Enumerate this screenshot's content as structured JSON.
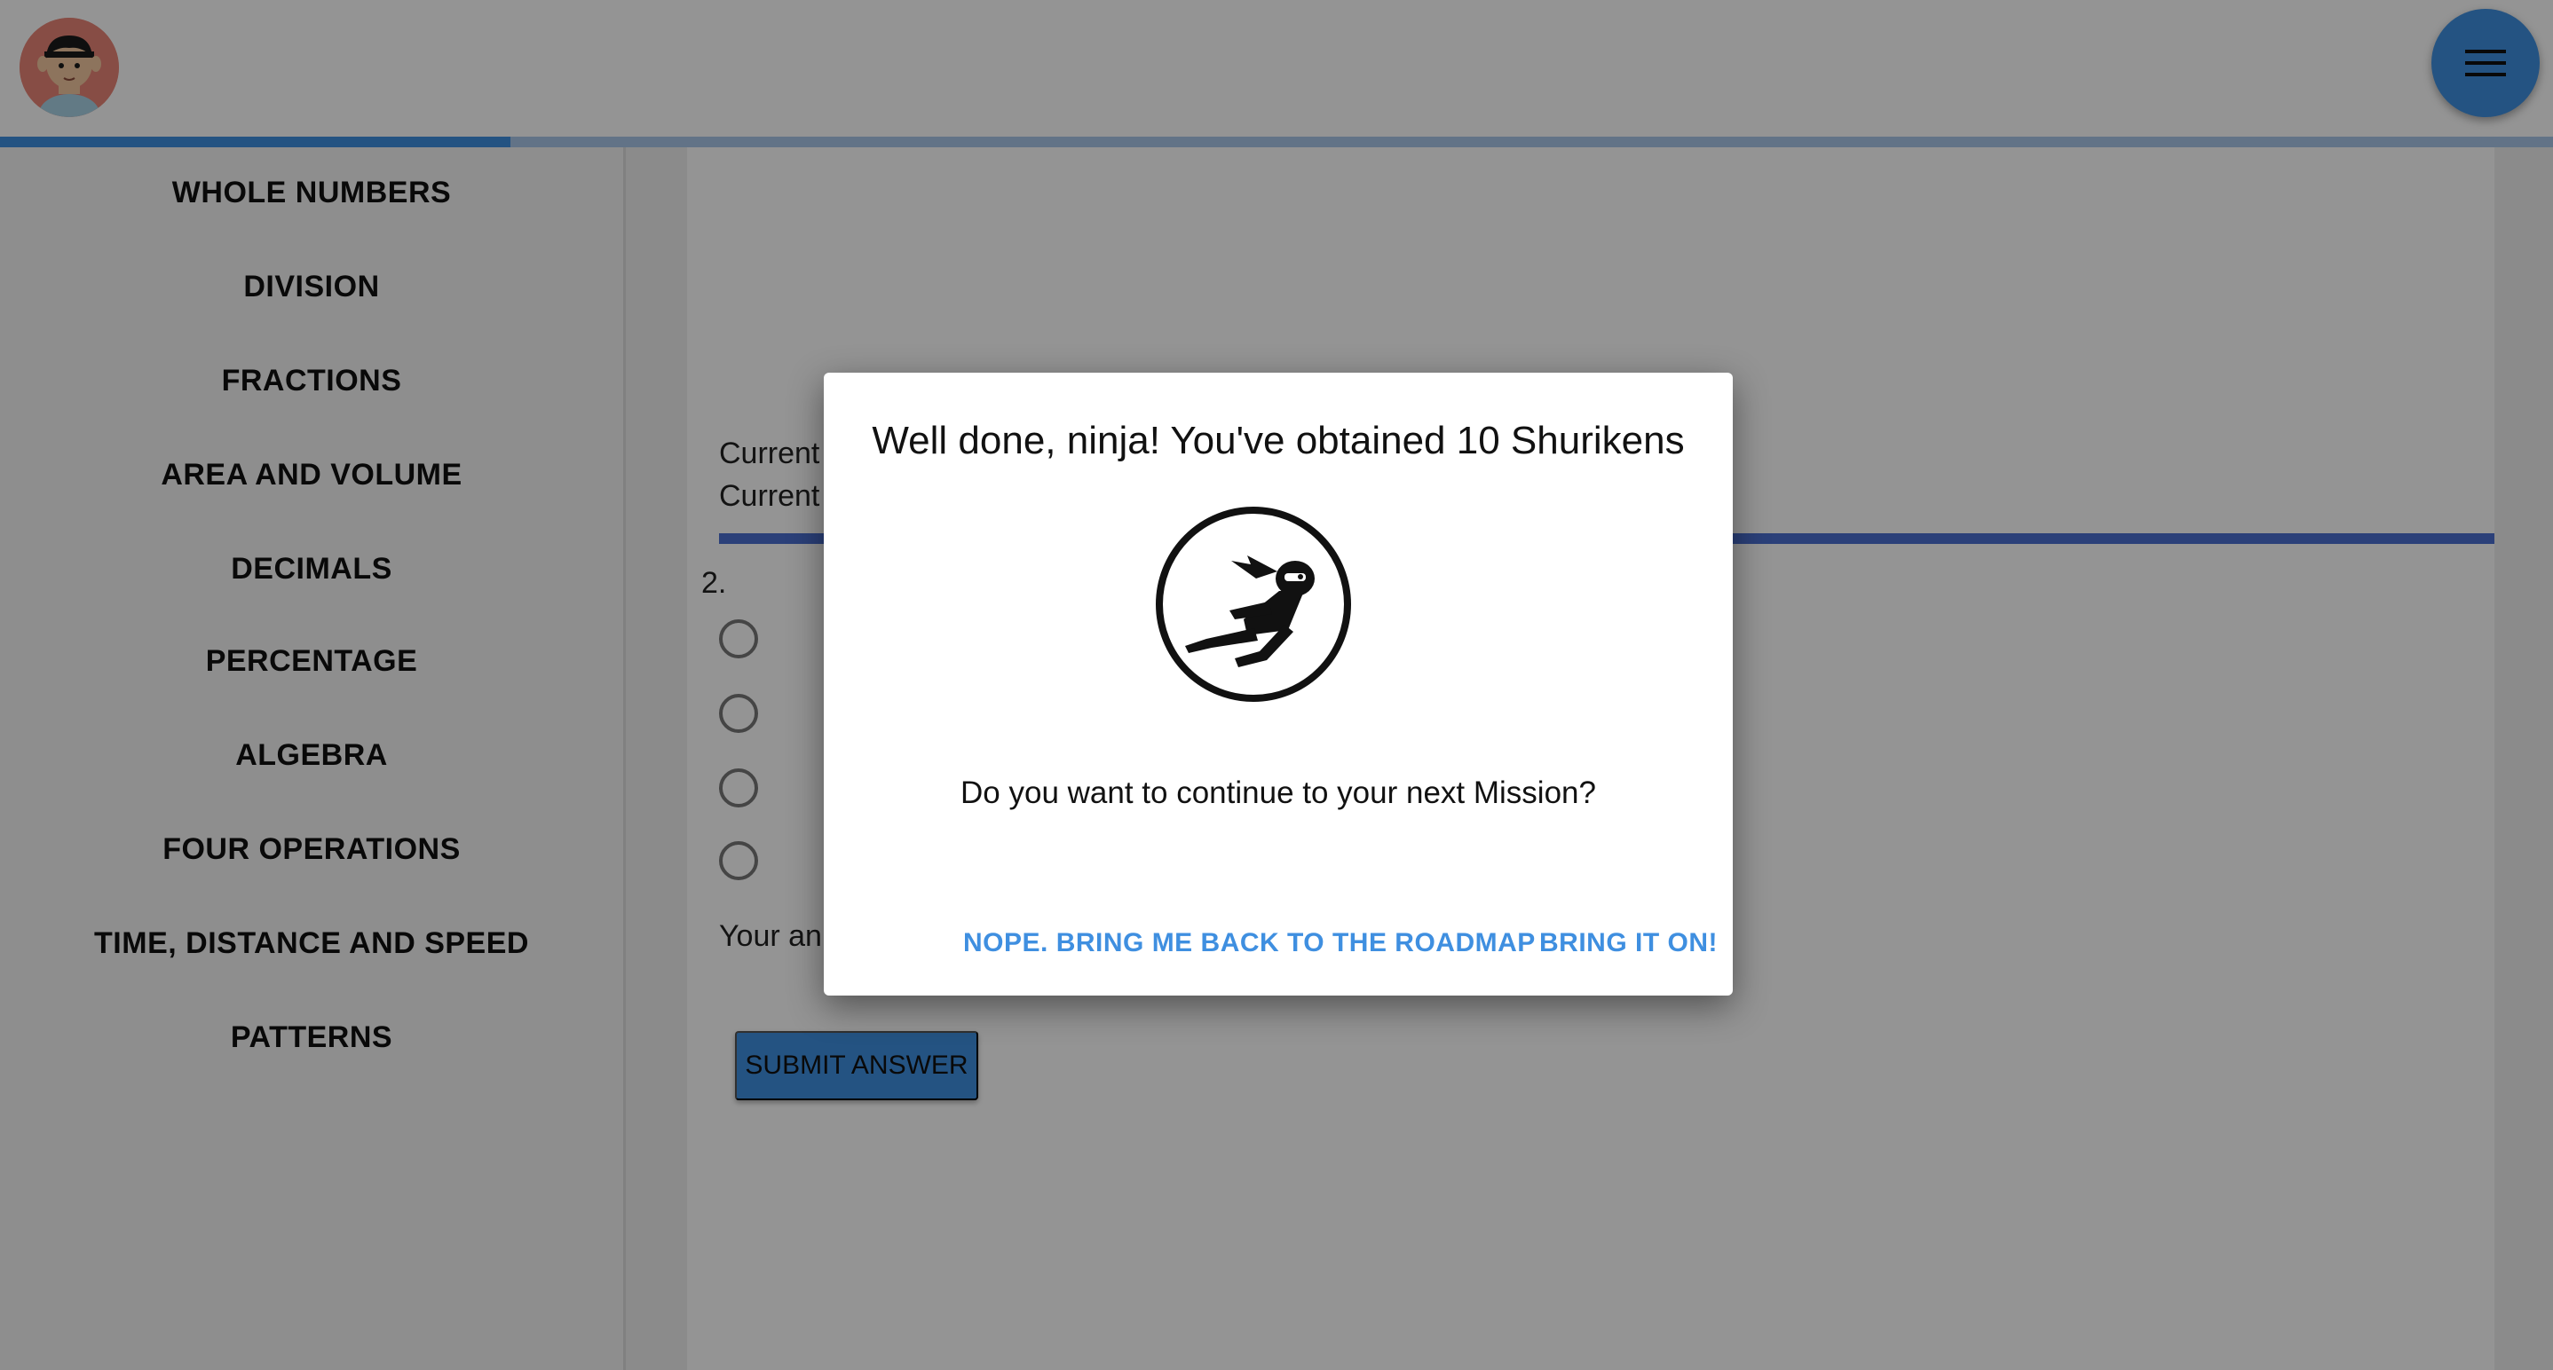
{
  "header": {
    "avatar_icon": "ninja-avatar-icon",
    "menu_icon": "hamburger-menu-icon",
    "progress_percent": 20,
    "colors": {
      "accent": "#3f8fe0",
      "avatar_bg": "#e98677"
    }
  },
  "sidebar": {
    "items": [
      {
        "label": "WHOLE NUMBERS"
      },
      {
        "label": "DIVISION"
      },
      {
        "label": "FRACTIONS"
      },
      {
        "label": "AREA AND VOLUME"
      },
      {
        "label": "DECIMALS"
      },
      {
        "label": "PERCENTAGE"
      },
      {
        "label": "ALGEBRA"
      },
      {
        "label": "FOUR OPERATIONS"
      },
      {
        "label": "TIME, DISTANCE AND SPEED"
      },
      {
        "label": "PATTERNS"
      }
    ]
  },
  "main": {
    "current_line_1": "Current",
    "current_line_2": "Current",
    "question_number": "2.",
    "options_count": 4,
    "your_answer_label": "Your an",
    "submit_label": "SUBMIT ANSWER"
  },
  "dialog": {
    "title": "Well done, ninja! You've obtained 10 Shurikens",
    "badge_icon": "ninja-running-icon",
    "message": "Do you want to continue to your next Mission?",
    "back_label": "NOPE. BRING ME BACK TO THE ROADMAP",
    "continue_label": "BRING IT ON!"
  }
}
